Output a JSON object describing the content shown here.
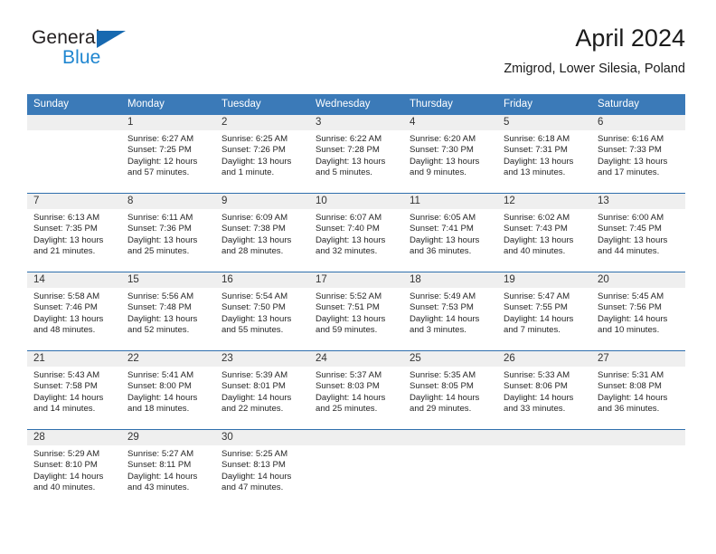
{
  "brand": {
    "name_top": "General",
    "name_bottom": "Blue",
    "triangle_color": "#1769b0",
    "blue_color": "#1f86d0"
  },
  "header": {
    "title": "April 2024",
    "subtitle": "Zmigrod, Lower Silesia, Poland"
  },
  "theme": {
    "header_blue": "#3b7ab8",
    "row_divider_blue": "#2f6fad",
    "daynum_band": "#efefef",
    "text": "#262626"
  },
  "columns": [
    "Sunday",
    "Monday",
    "Tuesday",
    "Wednesday",
    "Thursday",
    "Friday",
    "Saturday"
  ],
  "weeks": [
    [
      {
        "day": "",
        "blank": true,
        "sunrise": "",
        "sunset": "",
        "daylight1": "",
        "daylight2": ""
      },
      {
        "day": "1",
        "blank": false,
        "sunrise": "Sunrise: 6:27 AM",
        "sunset": "Sunset: 7:25 PM",
        "daylight1": "Daylight: 12 hours",
        "daylight2": "and 57 minutes."
      },
      {
        "day": "2",
        "blank": false,
        "sunrise": "Sunrise: 6:25 AM",
        "sunset": "Sunset: 7:26 PM",
        "daylight1": "Daylight: 13 hours",
        "daylight2": "and 1 minute."
      },
      {
        "day": "3",
        "blank": false,
        "sunrise": "Sunrise: 6:22 AM",
        "sunset": "Sunset: 7:28 PM",
        "daylight1": "Daylight: 13 hours",
        "daylight2": "and 5 minutes."
      },
      {
        "day": "4",
        "blank": false,
        "sunrise": "Sunrise: 6:20 AM",
        "sunset": "Sunset: 7:30 PM",
        "daylight1": "Daylight: 13 hours",
        "daylight2": "and 9 minutes."
      },
      {
        "day": "5",
        "blank": false,
        "sunrise": "Sunrise: 6:18 AM",
        "sunset": "Sunset: 7:31 PM",
        "daylight1": "Daylight: 13 hours",
        "daylight2": "and 13 minutes."
      },
      {
        "day": "6",
        "blank": false,
        "sunrise": "Sunrise: 6:16 AM",
        "sunset": "Sunset: 7:33 PM",
        "daylight1": "Daylight: 13 hours",
        "daylight2": "and 17 minutes."
      }
    ],
    [
      {
        "day": "7",
        "blank": false,
        "sunrise": "Sunrise: 6:13 AM",
        "sunset": "Sunset: 7:35 PM",
        "daylight1": "Daylight: 13 hours",
        "daylight2": "and 21 minutes."
      },
      {
        "day": "8",
        "blank": false,
        "sunrise": "Sunrise: 6:11 AM",
        "sunset": "Sunset: 7:36 PM",
        "daylight1": "Daylight: 13 hours",
        "daylight2": "and 25 minutes."
      },
      {
        "day": "9",
        "blank": false,
        "sunrise": "Sunrise: 6:09 AM",
        "sunset": "Sunset: 7:38 PM",
        "daylight1": "Daylight: 13 hours",
        "daylight2": "and 28 minutes."
      },
      {
        "day": "10",
        "blank": false,
        "sunrise": "Sunrise: 6:07 AM",
        "sunset": "Sunset: 7:40 PM",
        "daylight1": "Daylight: 13 hours",
        "daylight2": "and 32 minutes."
      },
      {
        "day": "11",
        "blank": false,
        "sunrise": "Sunrise: 6:05 AM",
        "sunset": "Sunset: 7:41 PM",
        "daylight1": "Daylight: 13 hours",
        "daylight2": "and 36 minutes."
      },
      {
        "day": "12",
        "blank": false,
        "sunrise": "Sunrise: 6:02 AM",
        "sunset": "Sunset: 7:43 PM",
        "daylight1": "Daylight: 13 hours",
        "daylight2": "and 40 minutes."
      },
      {
        "day": "13",
        "blank": false,
        "sunrise": "Sunrise: 6:00 AM",
        "sunset": "Sunset: 7:45 PM",
        "daylight1": "Daylight: 13 hours",
        "daylight2": "and 44 minutes."
      }
    ],
    [
      {
        "day": "14",
        "blank": false,
        "sunrise": "Sunrise: 5:58 AM",
        "sunset": "Sunset: 7:46 PM",
        "daylight1": "Daylight: 13 hours",
        "daylight2": "and 48 minutes."
      },
      {
        "day": "15",
        "blank": false,
        "sunrise": "Sunrise: 5:56 AM",
        "sunset": "Sunset: 7:48 PM",
        "daylight1": "Daylight: 13 hours",
        "daylight2": "and 52 minutes."
      },
      {
        "day": "16",
        "blank": false,
        "sunrise": "Sunrise: 5:54 AM",
        "sunset": "Sunset: 7:50 PM",
        "daylight1": "Daylight: 13 hours",
        "daylight2": "and 55 minutes."
      },
      {
        "day": "17",
        "blank": false,
        "sunrise": "Sunrise: 5:52 AM",
        "sunset": "Sunset: 7:51 PM",
        "daylight1": "Daylight: 13 hours",
        "daylight2": "and 59 minutes."
      },
      {
        "day": "18",
        "blank": false,
        "sunrise": "Sunrise: 5:49 AM",
        "sunset": "Sunset: 7:53 PM",
        "daylight1": "Daylight: 14 hours",
        "daylight2": "and 3 minutes."
      },
      {
        "day": "19",
        "blank": false,
        "sunrise": "Sunrise: 5:47 AM",
        "sunset": "Sunset: 7:55 PM",
        "daylight1": "Daylight: 14 hours",
        "daylight2": "and 7 minutes."
      },
      {
        "day": "20",
        "blank": false,
        "sunrise": "Sunrise: 5:45 AM",
        "sunset": "Sunset: 7:56 PM",
        "daylight1": "Daylight: 14 hours",
        "daylight2": "and 10 minutes."
      }
    ],
    [
      {
        "day": "21",
        "blank": false,
        "sunrise": "Sunrise: 5:43 AM",
        "sunset": "Sunset: 7:58 PM",
        "daylight1": "Daylight: 14 hours",
        "daylight2": "and 14 minutes."
      },
      {
        "day": "22",
        "blank": false,
        "sunrise": "Sunrise: 5:41 AM",
        "sunset": "Sunset: 8:00 PM",
        "daylight1": "Daylight: 14 hours",
        "daylight2": "and 18 minutes."
      },
      {
        "day": "23",
        "blank": false,
        "sunrise": "Sunrise: 5:39 AM",
        "sunset": "Sunset: 8:01 PM",
        "daylight1": "Daylight: 14 hours",
        "daylight2": "and 22 minutes."
      },
      {
        "day": "24",
        "blank": false,
        "sunrise": "Sunrise: 5:37 AM",
        "sunset": "Sunset: 8:03 PM",
        "daylight1": "Daylight: 14 hours",
        "daylight2": "and 25 minutes."
      },
      {
        "day": "25",
        "blank": false,
        "sunrise": "Sunrise: 5:35 AM",
        "sunset": "Sunset: 8:05 PM",
        "daylight1": "Daylight: 14 hours",
        "daylight2": "and 29 minutes."
      },
      {
        "day": "26",
        "blank": false,
        "sunrise": "Sunrise: 5:33 AM",
        "sunset": "Sunset: 8:06 PM",
        "daylight1": "Daylight: 14 hours",
        "daylight2": "and 33 minutes."
      },
      {
        "day": "27",
        "blank": false,
        "sunrise": "Sunrise: 5:31 AM",
        "sunset": "Sunset: 8:08 PM",
        "daylight1": "Daylight: 14 hours",
        "daylight2": "and 36 minutes."
      }
    ],
    [
      {
        "day": "28",
        "blank": false,
        "sunrise": "Sunrise: 5:29 AM",
        "sunset": "Sunset: 8:10 PM",
        "daylight1": "Daylight: 14 hours",
        "daylight2": "and 40 minutes."
      },
      {
        "day": "29",
        "blank": false,
        "sunrise": "Sunrise: 5:27 AM",
        "sunset": "Sunset: 8:11 PM",
        "daylight1": "Daylight: 14 hours",
        "daylight2": "and 43 minutes."
      },
      {
        "day": "30",
        "blank": false,
        "sunrise": "Sunrise: 5:25 AM",
        "sunset": "Sunset: 8:13 PM",
        "daylight1": "Daylight: 14 hours",
        "daylight2": "and 47 minutes."
      },
      {
        "day": "",
        "blank": true,
        "sunrise": "",
        "sunset": "",
        "daylight1": "",
        "daylight2": ""
      },
      {
        "day": "",
        "blank": true,
        "sunrise": "",
        "sunset": "",
        "daylight1": "",
        "daylight2": ""
      },
      {
        "day": "",
        "blank": true,
        "sunrise": "",
        "sunset": "",
        "daylight1": "",
        "daylight2": ""
      },
      {
        "day": "",
        "blank": true,
        "sunrise": "",
        "sunset": "",
        "daylight1": "",
        "daylight2": ""
      }
    ]
  ]
}
